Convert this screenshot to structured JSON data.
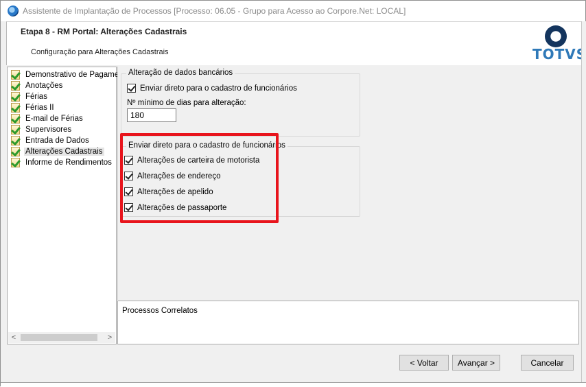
{
  "window": {
    "title": "Assistente de Implantação de Processos [Processo: 06.05 - Grupo para Acesso ao Corpore.Net: LOCAL]"
  },
  "header": {
    "step_title": "Etapa 8 - RM Portal: Alterações Cadastrais",
    "subtitle": "Configuração para Alterações Cadastrais",
    "logo_text": "TOTVS"
  },
  "sidebar": {
    "selected": "Alterações Cadastrais",
    "items": [
      {
        "label": "Demonstrativo de Pagamen"
      },
      {
        "label": "Anotações"
      },
      {
        "label": "Férias"
      },
      {
        "label": "Férias II"
      },
      {
        "label": "E-mail de Férias"
      },
      {
        "label": "Supervisores"
      },
      {
        "label": "Entrada de Dados"
      },
      {
        "label": "Alterações Cadastrais"
      },
      {
        "label": "Informe de Rendimentos"
      }
    ],
    "scroll_left": "<",
    "scroll_right": ">"
  },
  "bank_group": {
    "legend": "Alteração de dados bancários",
    "send_direct": {
      "label": "Enviar direto para o cadastro de funcionários",
      "checked": true
    },
    "min_days_label": "Nº mínimo de dias para alteração:",
    "min_days_value": "180"
  },
  "direct_group": {
    "legend": "Enviar direto para o cadastro de funcionários",
    "options": [
      {
        "label": "Alterações de carteira de motorista",
        "checked": true
      },
      {
        "label": "Alterações de endereço",
        "checked": true
      },
      {
        "label": "Alterações de apelido",
        "checked": true
      },
      {
        "label": "Alterações de passaporte",
        "checked": true
      }
    ],
    "highlight_color": "#e8141c"
  },
  "correlated": {
    "label": "Processos Correlatos"
  },
  "footer": {
    "back_label": "< Voltar",
    "next_label": "Avançar >",
    "cancel_label": "Cancelar"
  }
}
